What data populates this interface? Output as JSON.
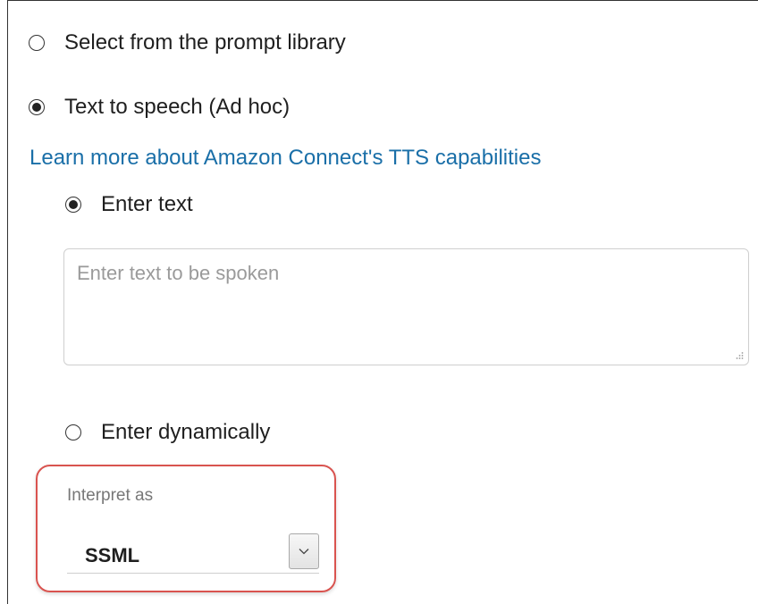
{
  "options": {
    "prompt_library": {
      "label": "Select from the prompt library",
      "checked": false
    },
    "tts_adhoc": {
      "label": "Text to speech (Ad hoc)",
      "checked": true
    }
  },
  "tts_link": {
    "label": "Learn more about Amazon Connect's TTS capabilities"
  },
  "text_mode": {
    "enter_text": {
      "label": "Enter text",
      "checked": true
    },
    "enter_dynamically": {
      "label": "Enter dynamically",
      "checked": false
    }
  },
  "text_input": {
    "value": "",
    "placeholder": "Enter text to be spoken"
  },
  "interpret_as": {
    "label": "Interpret as",
    "selected": "SSML",
    "highlight_color": "#d9534f"
  },
  "colors": {
    "link": "#1a6fa8",
    "text": "#1f1f1f",
    "placeholder": "#9a9a9a"
  }
}
